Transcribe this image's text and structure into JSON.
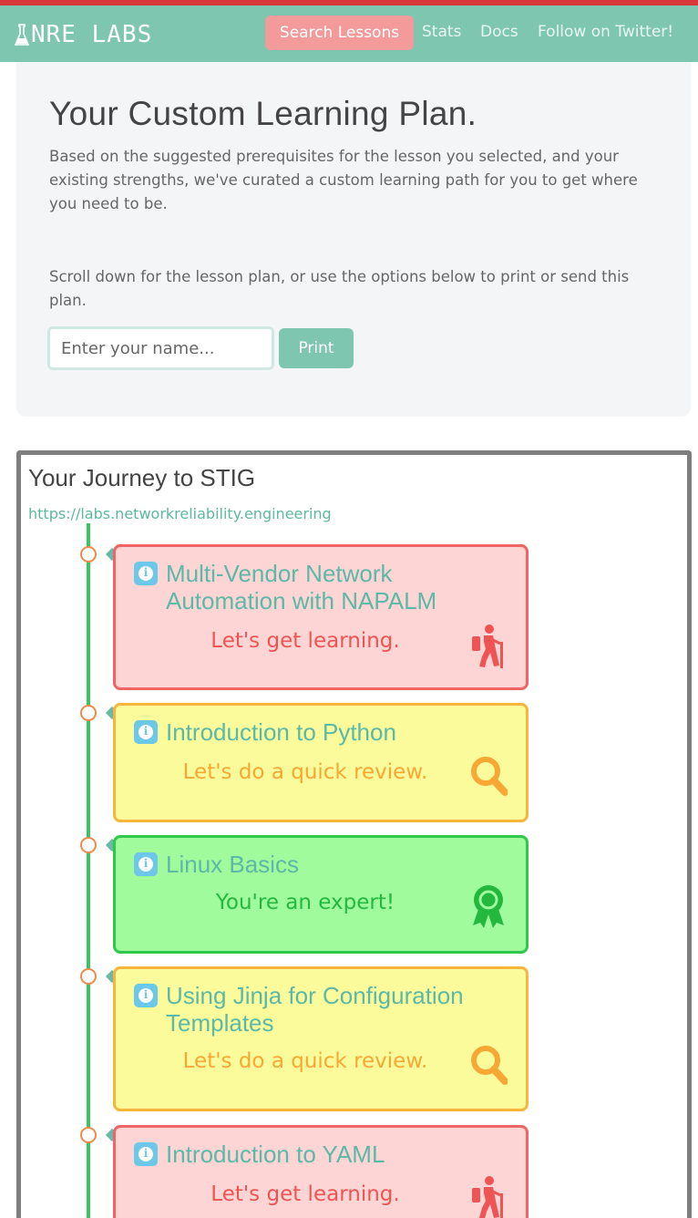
{
  "navbar": {
    "brand": "NRE LABS",
    "search_label": "Search Lessons",
    "links": [
      "Stats",
      "Docs",
      "Follow on Twitter!"
    ]
  },
  "jumbotron": {
    "title": "Your Custom Learning Plan.",
    "lead": "Based on the suggested prerequisites for the lesson you selected, and your existing strengths, we've curated a custom learning path for you to get where you need to be.",
    "hint": "Scroll down for the lesson plan, or use the options below to print or send this plan.",
    "name_placeholder": "Enter your name...",
    "print_label": "Print"
  },
  "plan": {
    "title": "Your Journey to STIG",
    "url": "https://labs.networkreliability.engineering",
    "lessons": [
      {
        "title": "Multi-Vendor Network Automation with NAPALM",
        "message": "Let's get learning.",
        "status": "learn",
        "icon": "hiker-icon"
      },
      {
        "title": "Introduction to Python",
        "message": "Let's do a quick review.",
        "status": "review",
        "icon": "magnifier-icon"
      },
      {
        "title": "Linux Basics",
        "message": "You're an expert!",
        "status": "expert",
        "icon": "ribbon-award-icon"
      },
      {
        "title": "Using Jinja for Configuration Templates",
        "message": "Let's do a quick review.",
        "status": "review",
        "icon": "magnifier-icon"
      },
      {
        "title": "Introduction to YAML",
        "message": "Let's get learning.",
        "status": "learn",
        "icon": "hiker-icon"
      }
    ]
  },
  "colors": {
    "navbar": "#7fc6b0",
    "search_button": "#f39a9b",
    "learn_bg": "#fdd5d5",
    "learn_border": "#ef6464",
    "review_bg": "#fbfb9c",
    "review_border": "#f8b53c",
    "expert_bg": "#9ffb9c",
    "expert_border": "#2ec94c",
    "timeline": "#36c85c"
  }
}
